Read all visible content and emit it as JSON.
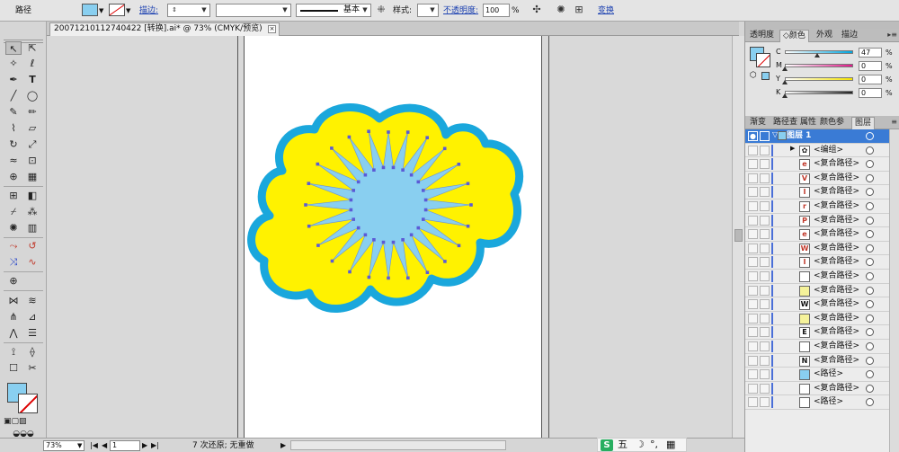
{
  "control_bar": {
    "selection_label": "路径",
    "fill_color": "#89cff0",
    "stroke_label": "描边:",
    "stroke_profile": "基本",
    "style_label": "样式:",
    "opacity_label": "不透明度:",
    "opacity_value": "100",
    "opacity_unit": "%",
    "transform_label": "变换"
  },
  "document": {
    "tab_title": "20071210112740422 [转换].ai* @ 73% (CMYK/预览)"
  },
  "status_bar": {
    "zoom": "73%",
    "page": "1",
    "message": "7 次还原; 无重做"
  },
  "ime": {
    "mode": "五"
  },
  "color_panel": {
    "tabs": [
      "透明度",
      "颜色",
      "外观",
      "描边"
    ],
    "active_tab": "颜色",
    "sliders": [
      {
        "label": "C",
        "value": "47",
        "unit": "%",
        "fraction": 0.47,
        "color": "#00a6e0"
      },
      {
        "label": "M",
        "value": "0",
        "unit": "%",
        "fraction": 0,
        "color": "#e0198a"
      },
      {
        "label": "Y",
        "value": "0",
        "unit": "%",
        "fraction": 0,
        "color": "#f5e400"
      },
      {
        "label": "K",
        "value": "0",
        "unit": "%",
        "fraction": 0,
        "color": "#222222"
      }
    ]
  },
  "layers_panel": {
    "tabs": [
      "渐变",
      "路径查",
      "属性",
      "颜色参",
      "图层"
    ],
    "active_tab": "图层",
    "layer_name": "图层 1",
    "items": [
      {
        "name": "<编组>",
        "thumb": "#ffffff",
        "glyph": "✿",
        "glyph_color": "#222"
      },
      {
        "name": "<复合路径>",
        "thumb": "#ffffff",
        "glyph": "e",
        "glyph_color": "#c0392b"
      },
      {
        "name": "<复合路径>",
        "thumb": "#ffffff",
        "glyph": "V",
        "glyph_color": "#c0392b"
      },
      {
        "name": "<复合路径>",
        "thumb": "#ffffff",
        "glyph": "I",
        "glyph_color": "#c0392b"
      },
      {
        "name": "<复合路径>",
        "thumb": "#ffffff",
        "glyph": "r",
        "glyph_color": "#c0392b"
      },
      {
        "name": "<复合路径>",
        "thumb": "#ffffff",
        "glyph": "P",
        "glyph_color": "#c0392b"
      },
      {
        "name": "<复合路径>",
        "thumb": "#ffffff",
        "glyph": "e",
        "glyph_color": "#c0392b"
      },
      {
        "name": "<复合路径>",
        "thumb": "#ffffff",
        "glyph": "W",
        "glyph_color": "#c0392b"
      },
      {
        "name": "<复合路径>",
        "thumb": "#ffffff",
        "glyph": "I",
        "glyph_color": "#c0392b"
      },
      {
        "name": "<复合路径>",
        "thumb": "#ffffff",
        "glyph": "",
        "glyph_color": "#222"
      },
      {
        "name": "<复合路径>",
        "thumb": "#f5f29a",
        "glyph": "",
        "glyph_color": "#222"
      },
      {
        "name": "<复合路径>",
        "thumb": "#ffffff",
        "glyph": "W",
        "glyph_color": "#111"
      },
      {
        "name": "<复合路径>",
        "thumb": "#f5f29a",
        "glyph": "",
        "glyph_color": "#222"
      },
      {
        "name": "<复合路径>",
        "thumb": "#ffffff",
        "glyph": "E",
        "glyph_color": "#111"
      },
      {
        "name": "<复合路径>",
        "thumb": "#ffffff",
        "glyph": "",
        "glyph_color": "#222"
      },
      {
        "name": "<复合路径>",
        "thumb": "#ffffff",
        "glyph": "N",
        "glyph_color": "#111"
      },
      {
        "name": "<路径>",
        "thumb": "#89cff0",
        "glyph": "",
        "glyph_color": "#222"
      },
      {
        "name": "<复合路径>",
        "thumb": "#ffffff",
        "glyph": "",
        "glyph_color": "#222"
      },
      {
        "name": "<路径>",
        "thumb": "#ffffff",
        "glyph": "",
        "glyph_color": "#222"
      }
    ]
  },
  "artwork": {
    "cloud_fill": "#fff200",
    "cloud_stroke": "#1aa7dc",
    "star_fill": "#89cff0",
    "anchor_color": "#5b5bd6"
  }
}
